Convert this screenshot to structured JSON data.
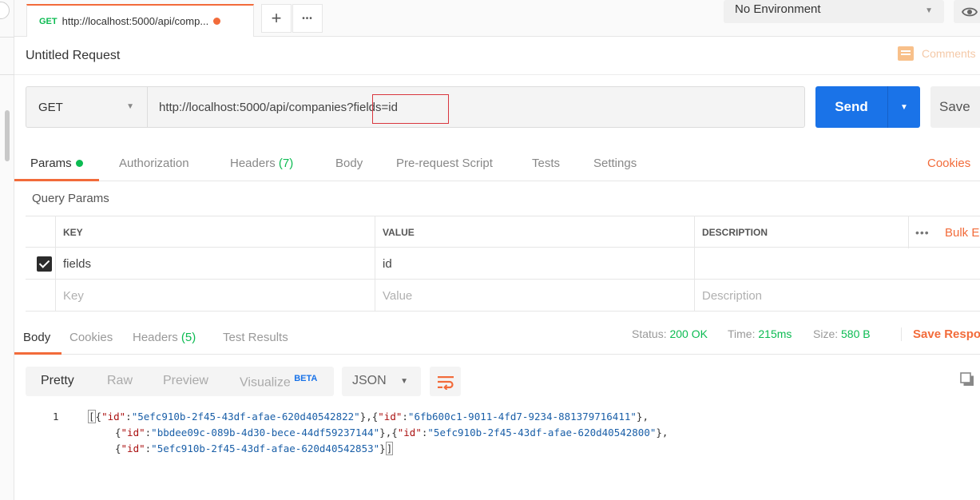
{
  "tab": {
    "method": "GET",
    "url": "http://localhost:5000/api/comp...",
    "add_symbol": "+",
    "more_symbol": "•••"
  },
  "environment": {
    "selected": "No Environment"
  },
  "request": {
    "title": "Untitled Request",
    "comments_label": "Comments",
    "method": "GET",
    "url_base": "http://localhost:5000/api/companies?",
    "url_query": "fields=id",
    "send_label": "Send",
    "save_label": "Save"
  },
  "request_tabs": {
    "params": "Params",
    "authorization": "Authorization",
    "headers": "Headers",
    "headers_count": "(7)",
    "body": "Body",
    "prerequest": "Pre-request Script",
    "tests": "Tests",
    "settings": "Settings",
    "cookies": "Cookies"
  },
  "query_params": {
    "label": "Query Params",
    "columns": [
      "KEY",
      "VALUE",
      "DESCRIPTION"
    ],
    "more_symbol": "•••",
    "bulk_label": "Bulk Edit",
    "rows": [
      {
        "key": "fields",
        "value": "id",
        "description": "",
        "checked": true
      }
    ],
    "placeholders": {
      "key": "Key",
      "value": "Value",
      "description": "Description"
    }
  },
  "response_tabs": {
    "body": "Body",
    "cookies": "Cookies",
    "headers": "Headers",
    "headers_count": "(5)",
    "test_results": "Test Results",
    "status_label": "Status:",
    "status_value": "200 OK",
    "time_label": "Time:",
    "time_value": "215ms",
    "size_label": "Size:",
    "size_value": "580 B",
    "save_response": "Save Response"
  },
  "response_toolbar": {
    "pretty": "Pretty",
    "raw": "Raw",
    "preview": "Preview",
    "visualize": "Visualize",
    "beta": "BETA",
    "format": "JSON"
  },
  "response_body": {
    "line_number": "1",
    "ids": [
      "5efc910b-2f45-43df-afae-620d40542822",
      "6fb600c1-9011-4fd7-9234-881379716411",
      "bbdee09c-089b-4d30-bece-44df59237144",
      "5efc910b-2f45-43df-afae-620d40542800",
      "5efc910b-2f45-43df-afae-620d40542853"
    ]
  },
  "colors": {
    "accent": "#f26b3a",
    "send_button": "#1a73e8",
    "success": "#0cbb52",
    "highlight_box": "#d9363e"
  }
}
